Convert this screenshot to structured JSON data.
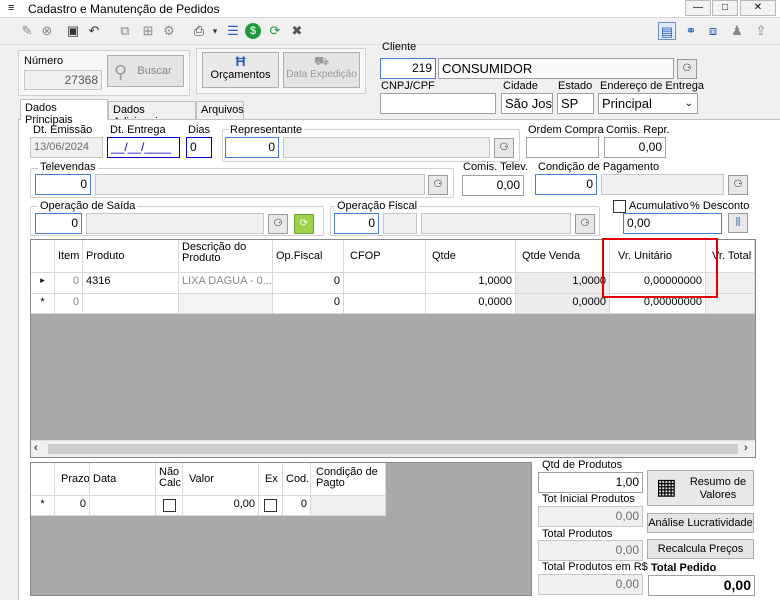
{
  "window": {
    "title": "Cadastro e Manutenção de Pedidos",
    "min": "—",
    "max": "□",
    "close": "✕"
  },
  "numero": {
    "label": "Número",
    "value": "27368",
    "buscar": "Buscar"
  },
  "orcamentos": {
    "label": "Orçamentos",
    "data_expedicao": "Data Expedição"
  },
  "cliente": {
    "label": "Cliente",
    "code": "219",
    "name": "CONSUMIDOR",
    "cnpj_label": "CNPJ/CPF",
    "cnpj": "",
    "cidade_label": "Cidade",
    "cidade": "São Jos",
    "estado_label": "Estado",
    "estado": "SP",
    "endereco_label": "Endereço de Entrega",
    "endereco": "Principal"
  },
  "tabs": [
    "Dados Principais",
    "Dados Adicionais",
    "Arquivos"
  ],
  "form": {
    "dt_emissao_label": "Dt. Emissão",
    "dt_emissao": "13/06/2024",
    "dt_entrega_label": "Dt. Entrega",
    "dt_entrega": "__/__/____",
    "dias_label": "Dias",
    "dias": "0",
    "representante_label": "Representante",
    "representante_code": "0",
    "ordem_compra_label": "Ordem Compra",
    "comis_repr_label": "Comis. Repr.",
    "comis_repr": "0,00",
    "televendas_label": "Televendas",
    "televendas_code": "0",
    "comis_telev_label": "Comis. Telev.",
    "comis_telev": "0,00",
    "cond_pag_label": "Condição de Pagamento",
    "cond_pag_code": "0",
    "op_saida_label": "Operação de Saída",
    "op_saida_code": "0",
    "op_fiscal_label": "Operação Fiscal",
    "op_fiscal_code": "0",
    "acumulativo_label": "Acumulativo",
    "desconto_label": "% Desconto",
    "desconto": "0,00"
  },
  "grid": {
    "headers": [
      "Item",
      "Produto",
      "Descrição do Produto",
      "Op.Fiscal",
      "CFOP",
      "Qtde",
      "Qtde Venda",
      "Vr. Unitário",
      "Vr. Total"
    ],
    "rows": [
      {
        "marker": "▸",
        "item": "0",
        "produto": "4316",
        "descricao": "LIXA DAGUA - 0...",
        "op_fiscal": "0",
        "cfop": "",
        "qtde": "1,0000",
        "qtde_venda": "1,0000",
        "vr_unit": "0,00000000"
      },
      {
        "marker": "*",
        "item": "0",
        "produto": "",
        "descricao": "",
        "op_fiscal": "0",
        "cfop": "",
        "qtde": "0,0000",
        "qtde_venda": "0,0000",
        "vr_unit": "0,00000000"
      }
    ]
  },
  "payments": {
    "headers": [
      "Prazo",
      "Data",
      "Não Calc",
      "Valor",
      "Ex",
      "Cod.",
      "Condição de Pagto"
    ],
    "row": {
      "marker": "*",
      "prazo": "0",
      "data": "",
      "valor": "0,00",
      "cod": "0"
    }
  },
  "totals": {
    "qtd_label": "Qtd de Produtos",
    "qtd": "1,00",
    "tot_inicial_label": "Tot Inicial Produtos",
    "tot_inicial": "0,00",
    "total_prod_label": "Total Produtos",
    "total_prod": "0,00",
    "total_rs_label": "Total Produtos em R$",
    "total_rs": "0,00",
    "total_pedido_label": "Total Pedido",
    "total_pedido": "0,00",
    "resumo": "Resumo de Valores",
    "analise": "Análise Lucratividade",
    "recalcula": "Recalcula Preços"
  },
  "colors": {
    "highlight": "#e00000",
    "accent": "#2a5fb0"
  }
}
